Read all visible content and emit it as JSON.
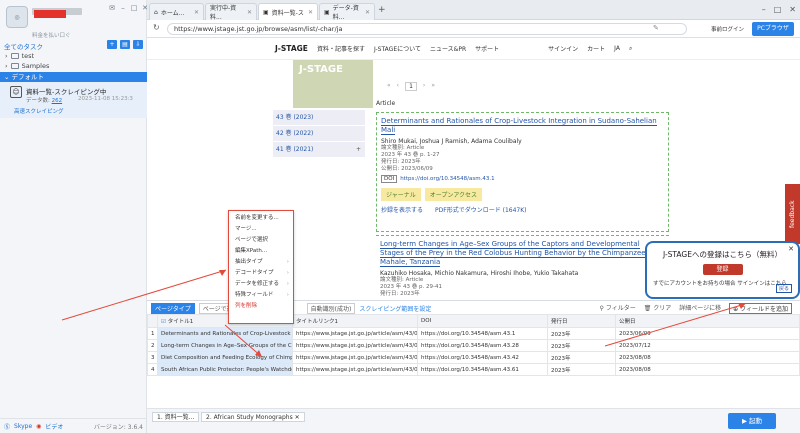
{
  "sidebar": {
    "subtitle": "料金を払い口ぐ",
    "task_header": "全てのタスク",
    "tree": [
      "test",
      "Samples"
    ],
    "group": "デフォルト",
    "task": {
      "title": "資料一覧-スクレイピング中",
      "count_label": "データ数:",
      "count": "262",
      "time": "2023-11-08 15:23:3",
      "link": "高速スクレイピング"
    },
    "footer": {
      "skype": "Skype",
      "video": "ビデオ",
      "version": "バージョン: 3.6.4"
    }
  },
  "browser": {
    "tabs": [
      "ホーム...",
      "実行中-資料...",
      "資料一覧-ス",
      "データ-資料..."
    ],
    "url": "https://www.jstage.jst.go.jp/browse/asm/list/-char/ja",
    "login": "事前ログイン",
    "pc_button": "PCブラウザ"
  },
  "jstage": {
    "logo": "J-STAGE",
    "nav": [
      "資料・記事を探す",
      "J-STAGEについて",
      "ニュース&PR",
      "サポート",
      "サインイン",
      "カート",
      "JA"
    ],
    "cover_text": "J-STAGE",
    "page_num": "1",
    "volumes": [
      "43 巻 (2023)",
      "42 巻 (2022)",
      "41 巻 (2021)"
    ],
    "article_label": "Article",
    "article1": {
      "title": "Determinants and Rationales of Crop-Livestock Integration in Sudano-Sahelian Mali",
      "authors": "Shiro Mukai, Joshua J Ramish, Adama Coulibaly",
      "type": "論文種別: Article",
      "vol": "2023 年 43 巻 p. 1-27",
      "pub": "発行日: 2023年",
      "open": "公開日: 2023/06/09",
      "doi_badge": "DOI",
      "doi": "https://doi.org/10.34548/asm.43.1",
      "tags": [
        "ジャーナル",
        "オープンアクセス"
      ],
      "abstract": "抄録を表示する",
      "pdf": "PDF形式でダウンロード (1647K)"
    },
    "article2": {
      "title": "Long-term Changes in Age–Sex Groups of the Captors and Developmental Stages of the Prey in the Red Colobus Hunting Behavior by the Chimpanzees of Mahale, Tanzania",
      "authors": "Kazuhiko Hosaka, Michio Nakamura, Hiroshi Ihobe, Yukio Takahata",
      "type": "論文種別: Article",
      "vol": "2023 年 43 巻 p. 29-41",
      "pub": "発行日: 2023年"
    },
    "popup": {
      "title": "J-STAGEへの登録はこちら（無料）",
      "button": "登録",
      "sub": "すでにアカウントをお持ちの場合 サインインはこちら",
      "back": "戻る"
    },
    "feedback": "feedback"
  },
  "context_menu": [
    "名前を変更する...",
    "マージ...",
    "ページで選択",
    "編集XPath...",
    "抽出タイプ",
    "デコードタイプ",
    "データを修正する",
    "特殊フィールド",
    "列を削除"
  ],
  "panel": {
    "tab": "ページタイプ",
    "box1": "ページで選択",
    "box2": "自動識別(成功)",
    "link": "スクレイピング範囲を設定",
    "filter": "フィルター",
    "clear": "クリア",
    "detail": "詳細ページに移",
    "add_field": "フィールドを追加",
    "columns": [
      "",
      "タイトル1",
      "タイトルリンク1",
      "DOI",
      "発行日",
      "公開日"
    ],
    "rows": [
      [
        "1",
        "Determinants and Rationales of Crop-Livestock Inte...",
        "https://www.jstage.jst.go.jp/article/asm/43/0/43_43.1/...",
        "https://doi.org/10.34548/asm.43.1",
        "2023年",
        "2023/06/09"
      ],
      [
        "2",
        "Long-term Changes in Age–Sex Groups of the Capt...",
        "https://www.jstage.jst.go.jp/article/asm/43/0/43_43.28/...",
        "https://doi.org/10.34548/asm.43.28",
        "2023年",
        "2023/07/12"
      ],
      [
        "3",
        "Diet Composition and Feeding Ecology of Chimpanz...",
        "https://www.jstage.jst.go.jp/article/asm/43/0/43_43.42/...",
        "https://doi.org/10.34548/asm.43.42",
        "2023年",
        "2023/08/08"
      ],
      [
        "4",
        "South African Public Protector: People's Watchdog o...",
        "https://www.jstage.jst.go.jp/article/asm/43/0/43_43.61/...",
        "https://doi.org/10.34548/asm.43.61",
        "2023年",
        "2023/08/08"
      ]
    ]
  },
  "bottom": {
    "tabs": [
      "1. 資料一覧...",
      "2. African Study Monographs"
    ],
    "run": "起動"
  },
  "colors": {
    "accent": "#2b83e8",
    "annotation": "#e24a3b"
  }
}
